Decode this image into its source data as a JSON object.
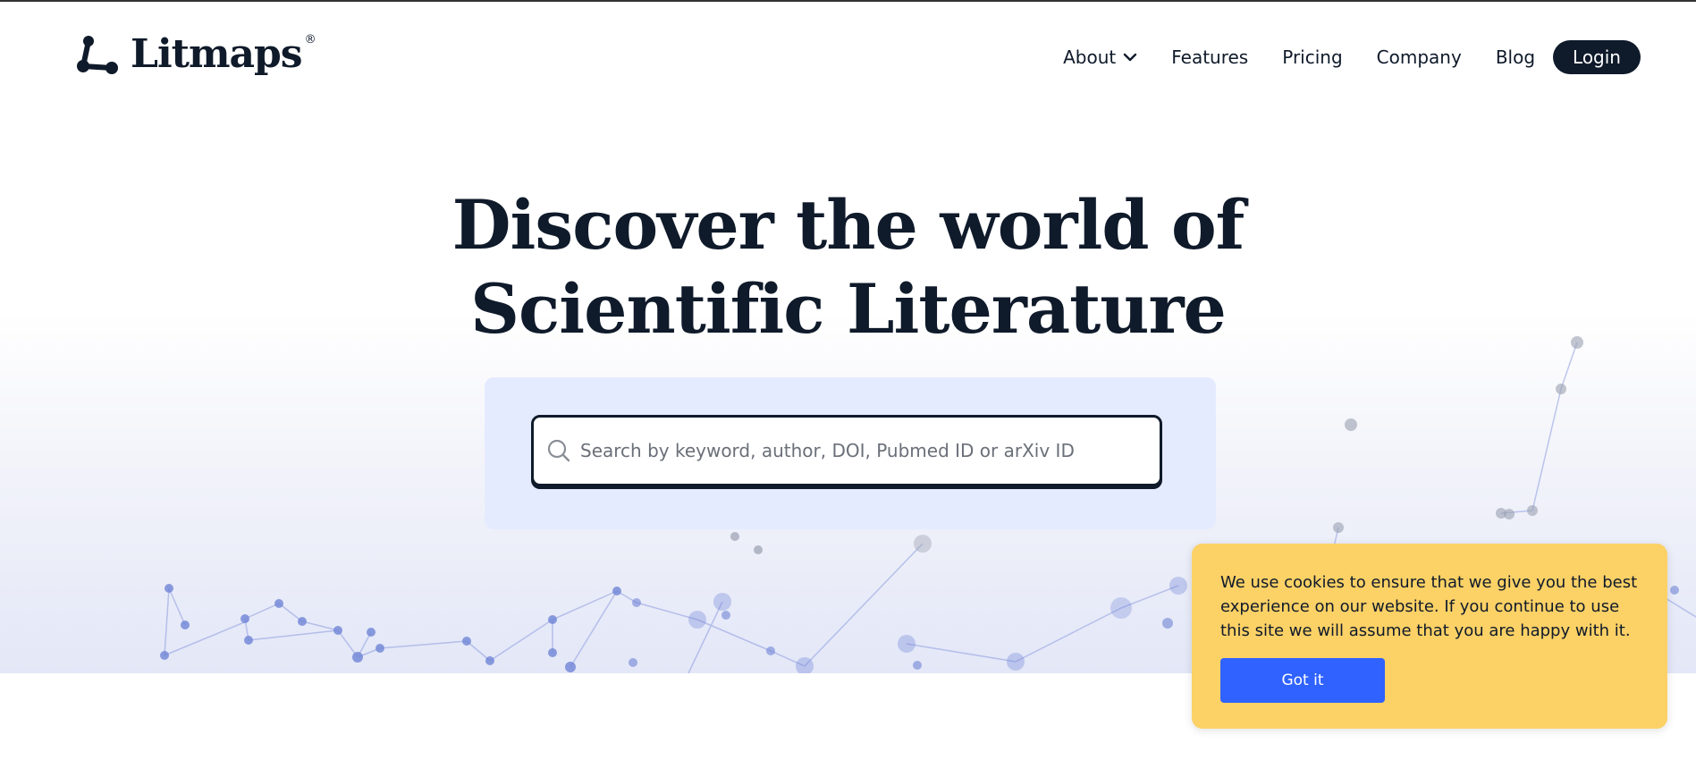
{
  "brand": {
    "name": "Litmaps",
    "registered_mark": "®"
  },
  "nav": {
    "items": [
      {
        "label": "About",
        "has_dropdown": true
      },
      {
        "label": "Features"
      },
      {
        "label": "Pricing"
      },
      {
        "label": "Company"
      },
      {
        "label": "Blog"
      }
    ],
    "login_label": "Login"
  },
  "hero": {
    "title_line1": "Discover the world of",
    "title_line2": "Scientific Literature"
  },
  "search": {
    "placeholder": "Search by keyword, author, DOI, Pubmed ID or arXiv ID",
    "value": ""
  },
  "cookie_banner": {
    "message": "We use cookies to ensure that we give you the best experience on our website. If you continue to use this site we will assume that you are happy with it.",
    "button_label": "Got it"
  },
  "colors": {
    "text_primary": "#0f1a2a",
    "search_panel_bg": "#e5ebff",
    "cookie_bg": "#fcd166",
    "cookie_button": "#2f62ff",
    "network_nodes": "#6f84d6"
  },
  "icons": {
    "logo": "litmaps-graph-logo-icon",
    "search": "search-icon",
    "about_dropdown": "chevron-down-icon"
  }
}
